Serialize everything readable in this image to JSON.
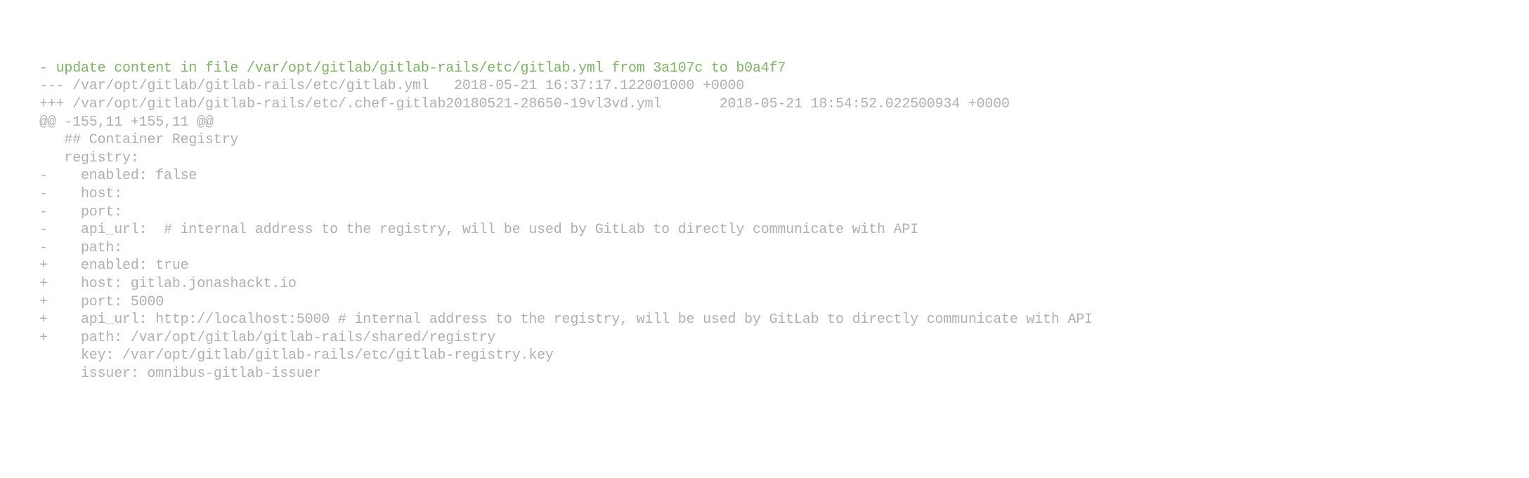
{
  "diff": {
    "lines": [
      {
        "cls": "header-line",
        "text": "- update content in file /var/opt/gitlab/gitlab-rails/etc/gitlab.yml from 3a107c to b0a4f7"
      },
      {
        "cls": "",
        "text": "--- /var/opt/gitlab/gitlab-rails/etc/gitlab.yml   2018-05-21 16:37:17.122001000 +0000"
      },
      {
        "cls": "",
        "text": "+++ /var/opt/gitlab/gitlab-rails/etc/.chef-gitlab20180521-28650-19vl3vd.yml       2018-05-21 18:54:52.022500934 +0000"
      },
      {
        "cls": "",
        "text": "@@ -155,11 +155,11 @@"
      },
      {
        "cls": "",
        "text": ""
      },
      {
        "cls": "",
        "text": "   ## Container Registry"
      },
      {
        "cls": "",
        "text": "   registry:"
      },
      {
        "cls": "",
        "text": "-    enabled: false"
      },
      {
        "cls": "",
        "text": "-    host: "
      },
      {
        "cls": "",
        "text": "-    port: "
      },
      {
        "cls": "",
        "text": "-    api_url:  # internal address to the registry, will be used by GitLab to directly communicate with API"
      },
      {
        "cls": "",
        "text": "-    path: "
      },
      {
        "cls": "",
        "text": "+    enabled: true"
      },
      {
        "cls": "",
        "text": "+    host: gitlab.jonashackt.io"
      },
      {
        "cls": "",
        "text": "+    port: 5000"
      },
      {
        "cls": "",
        "text": "+    api_url: http://localhost:5000 # internal address to the registry, will be used by GitLab to directly communicate with API"
      },
      {
        "cls": "",
        "text": "+    path: /var/opt/gitlab/gitlab-rails/shared/registry"
      },
      {
        "cls": "",
        "text": "     key: /var/opt/gitlab/gitlab-rails/etc/gitlab-registry.key"
      },
      {
        "cls": "",
        "text": "     issuer: omnibus-gitlab-issuer"
      }
    ]
  }
}
